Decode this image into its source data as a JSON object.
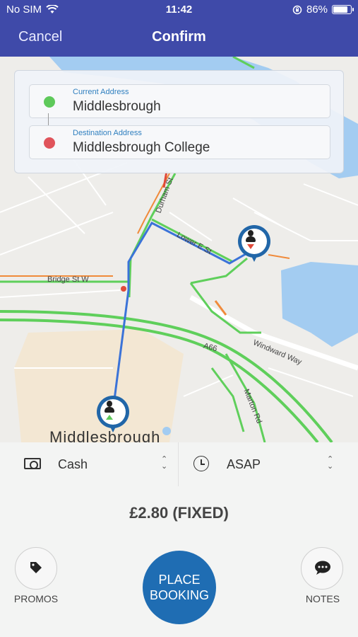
{
  "status_bar": {
    "carrier": "No SIM",
    "time": "11:42",
    "battery_percent": "86%",
    "battery_level": 0.86
  },
  "nav": {
    "cancel_label": "Cancel",
    "title": "Confirm"
  },
  "addresses": {
    "current_label": "Current Address",
    "current_value": "Middlesbrough",
    "destination_label": "Destination Address",
    "destination_value": "Middlesbrough College",
    "colors": {
      "current_dot": "#5ec95a",
      "destination_dot": "#e0545b"
    }
  },
  "map": {
    "street_labels": [
      "Durham St",
      "Lower E St",
      "Bridge St W",
      "Windward Way",
      "A66",
      "Marton Rd"
    ],
    "city_label": "Middlesbrough",
    "colors": {
      "water": "#a3ccf1",
      "route": "#3b73d8",
      "road_green": "#5fcf5b",
      "road_orange": "#f08a3a",
      "road_red": "#e04a3a"
    }
  },
  "booking": {
    "payment_label": "Cash",
    "time_label": "ASAP",
    "price": "£2.80 (FIXED)",
    "promos_label": "PROMOS",
    "notes_label": "NOTES",
    "place_line1": "PLACE",
    "place_line2": "BOOKING",
    "accent": "#1f6db3",
    "icons": [
      "cash-icon",
      "clock-icon",
      "tag-icon",
      "chat-icon",
      "wifi-icon",
      "rotation-lock-icon",
      "battery-icon"
    ]
  }
}
